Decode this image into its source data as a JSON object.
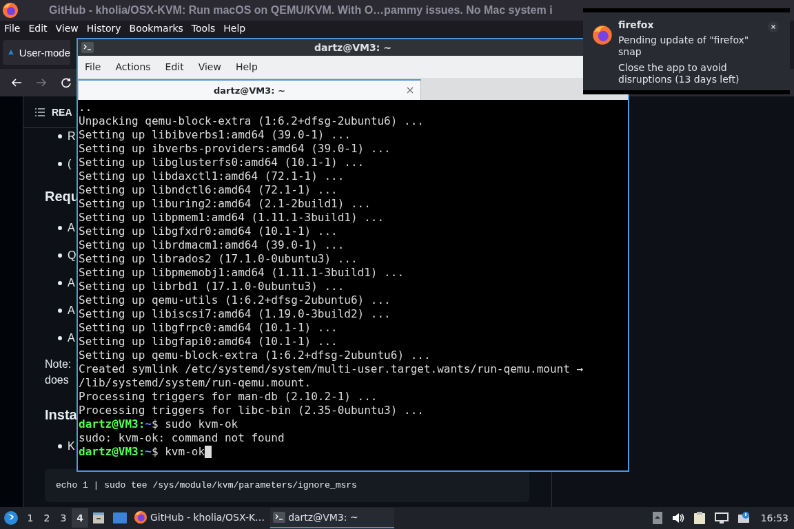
{
  "browser": {
    "title": "GitHub - kholia/OSX-KVM: Run macOS on QEMU/KVM. With O…pammy issues. No Mac system i",
    "menu": [
      "File",
      "Edit",
      "View",
      "History",
      "Bookmarks",
      "Tools",
      "Help"
    ],
    "tab": {
      "label": "User-mode"
    },
    "page": {
      "toc_label": "REA",
      "blocks": [
        {
          "kind": "bullet",
          "text": "R"
        },
        {
          "kind": "bullet",
          "text": "("
        },
        {
          "kind": "heading",
          "text": "Requ"
        },
        {
          "kind": "bullet",
          "text": "A"
        },
        {
          "kind": "bullet",
          "text": "Q"
        },
        {
          "kind": "bullet",
          "text": "A"
        },
        {
          "kind": "bullet",
          "text": "A"
        },
        {
          "kind": "bullet",
          "text": "A"
        },
        {
          "kind": "para",
          "text": "Note:"
        },
        {
          "kind": "para",
          "text": "does"
        },
        {
          "kind": "heading",
          "text": "Insta"
        },
        {
          "kind": "bullet",
          "text": "K"
        },
        {
          "kind": "code",
          "text": "echo 1 | sudo tee /sys/module/kvm/parameters/ignore_msrs"
        }
      ]
    }
  },
  "terminal": {
    "title": "dartz@VM3: ~",
    "menu": [
      "File",
      "Actions",
      "Edit",
      "View",
      "Help"
    ],
    "tab": {
      "label": "dartz@VM3: ~",
      "selected": true
    },
    "lines": [
      {
        "kind": "output",
        "text": ".."
      },
      {
        "kind": "output",
        "text": "Unpacking qemu-block-extra (1:6.2+dfsg-2ubuntu6) ..."
      },
      {
        "kind": "output",
        "text": "Setting up libibverbs1:amd64 (39.0-1) ..."
      },
      {
        "kind": "output",
        "text": "Setting up ibverbs-providers:amd64 (39.0-1) ..."
      },
      {
        "kind": "output",
        "text": "Setting up libglusterfs0:amd64 (10.1-1) ..."
      },
      {
        "kind": "output",
        "text": "Setting up libdaxctl1:amd64 (72.1-1) ..."
      },
      {
        "kind": "output",
        "text": "Setting up libndctl6:amd64 (72.1-1) ..."
      },
      {
        "kind": "output",
        "text": "Setting up liburing2:amd64 (2.1-2build1) ..."
      },
      {
        "kind": "output",
        "text": "Setting up libpmem1:amd64 (1.11.1-3build1) ..."
      },
      {
        "kind": "output",
        "text": "Setting up libgfxdr0:amd64 (10.1-1) ..."
      },
      {
        "kind": "output",
        "text": "Setting up librdmacm1:amd64 (39.0-1) ..."
      },
      {
        "kind": "output",
        "text": "Setting up librados2 (17.1.0-0ubuntu3) ..."
      },
      {
        "kind": "output",
        "text": "Setting up libpmemobj1:amd64 (1.11.1-3build1) ..."
      },
      {
        "kind": "output",
        "text": "Setting up librbd1 (17.1.0-0ubuntu3) ..."
      },
      {
        "kind": "output",
        "text": "Setting up qemu-utils (1:6.2+dfsg-2ubuntu6) ..."
      },
      {
        "kind": "output",
        "text": "Setting up libiscsi7:amd64 (1.19.0-3build2) ..."
      },
      {
        "kind": "output",
        "text": "Setting up libgfrpc0:amd64 (10.1-1) ..."
      },
      {
        "kind": "output",
        "text": "Setting up libgfapi0:amd64 (10.1-1) ..."
      },
      {
        "kind": "output",
        "text": "Setting up qemu-block-extra (1:6.2+dfsg-2ubuntu6) ..."
      },
      {
        "kind": "output",
        "text": "Created symlink /etc/systemd/system/multi-user.target.wants/run-qemu.mount →"
      },
      {
        "kind": "output",
        "text": "/lib/systemd/system/run-qemu.mount."
      },
      {
        "kind": "output",
        "text": "Processing triggers for man-db (2.10.2-1) ..."
      },
      {
        "kind": "output",
        "text": "Processing triggers for libc-bin (2.35-0ubuntu3) ..."
      },
      {
        "kind": "prompt",
        "user": "dartz@VM3:",
        "path": "~",
        "command": "$ sudo kvm-ok"
      },
      {
        "kind": "output",
        "text": "sudo: kvm-ok: command not found"
      },
      {
        "kind": "prompt",
        "user": "dartz@VM3:",
        "path": "~",
        "command": "$ kvm-ok",
        "cursor": true
      }
    ]
  },
  "notification": {
    "app": "firefox",
    "lines": [
      "Pending update of \"firefox\" snap",
      "Close the app to avoid disruptions (13 days left)"
    ]
  },
  "taskbar": {
    "workspaces": [
      {
        "label": "1",
        "selected": false
      },
      {
        "label": "2",
        "selected": false
      },
      {
        "label": "3",
        "selected": false
      },
      {
        "label": "4",
        "selected": true
      }
    ],
    "tasks": [
      {
        "kind": "browser",
        "label": "GitHub - kholia/OSX-K…",
        "selected": false
      },
      {
        "kind": "terminal",
        "label": "dartz@VM3: ~",
        "selected": true
      }
    ],
    "clock": "16:53"
  }
}
